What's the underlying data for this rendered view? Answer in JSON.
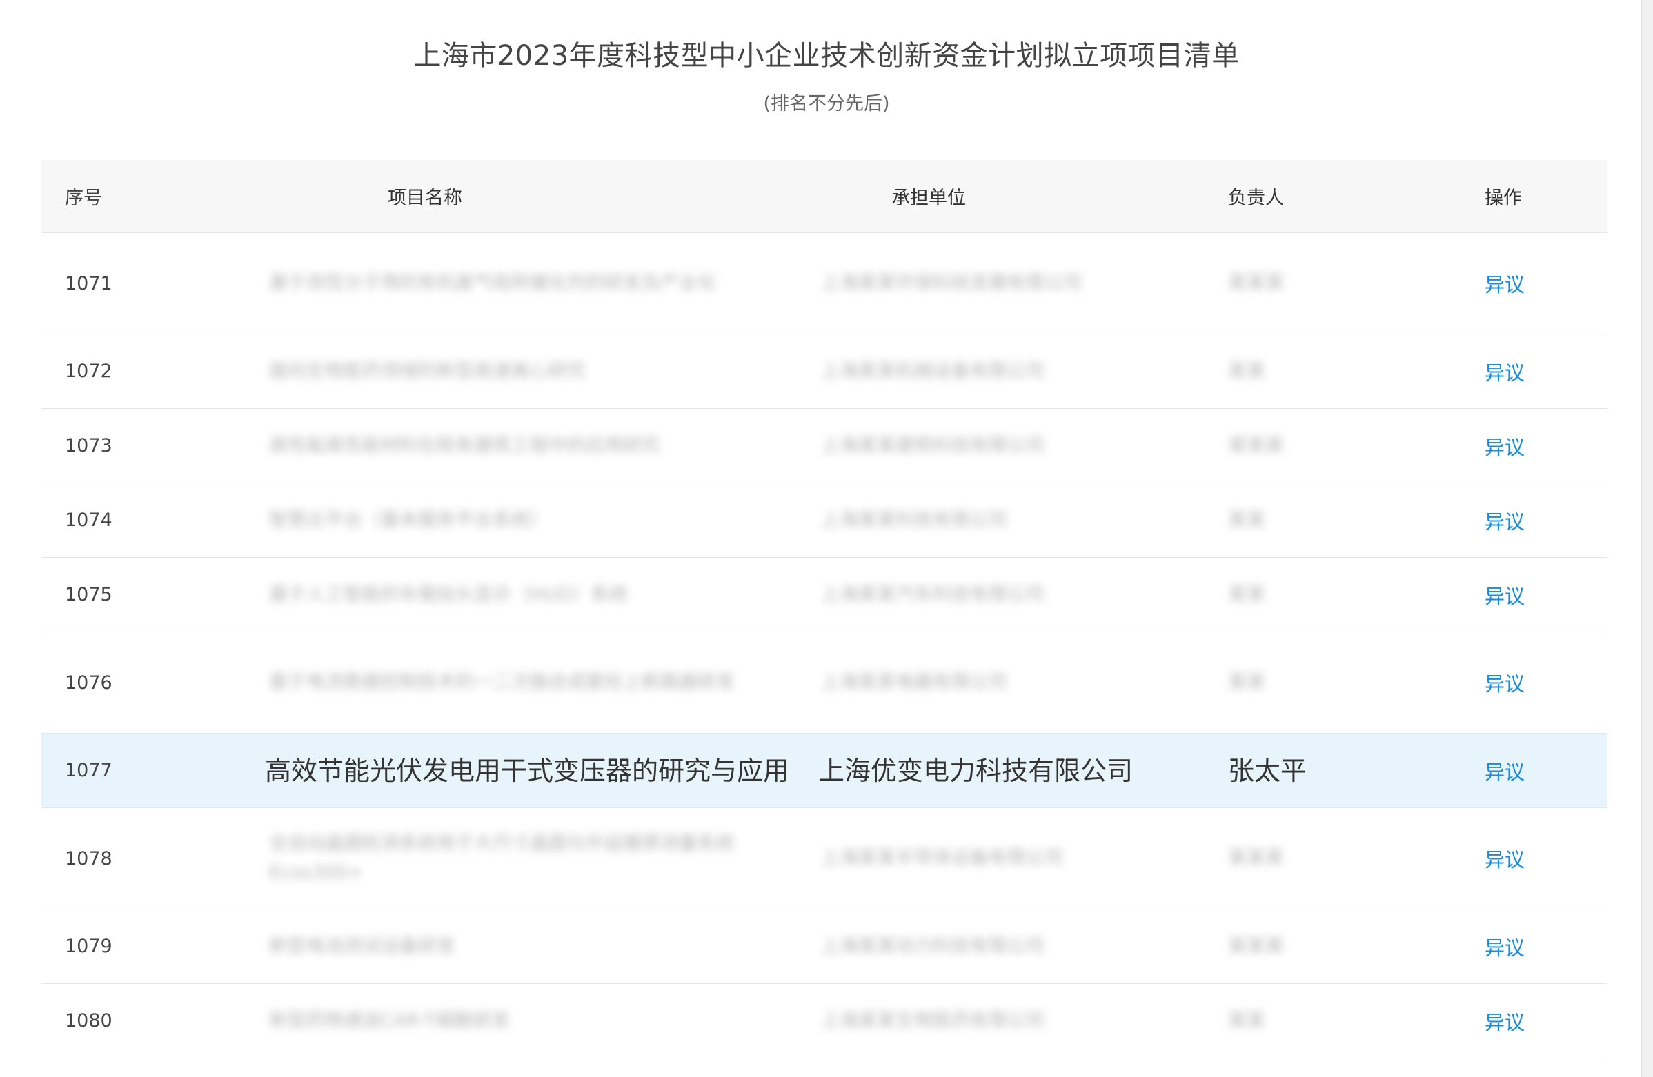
{
  "page": {
    "title": "上海市2023年度科技型中小企业技术创新资金计划拟立项项目清单",
    "subtitle": "(排名不分先后)"
  },
  "table": {
    "headers": {
      "no": "序号",
      "name": "项目名称",
      "unit": "承担单位",
      "person": "负责人",
      "op": "操作"
    },
    "rows": [
      {
        "no": "1071",
        "name": "基于改性分子筛的有机废气吸附催化剂的研发及产业化",
        "unit": "上海某某环保科技发展有限公司",
        "person": "某某某",
        "op": "异议"
      },
      {
        "no": "1072",
        "name": "面向生物医药领域的新型高速离心研究",
        "unit": "上海某某机械设备有限公司",
        "person": "某某",
        "op": "异议"
      },
      {
        "no": "1073",
        "name": "高性能高性能材料在既有建筑工程中的应用研究",
        "unit": "上海某某建筑科技有限公司",
        "person": "某某某",
        "op": "异议"
      },
      {
        "no": "1074",
        "name": "智慧云平台（基本服务平台系统）",
        "unit": "上海某某科技有限公司",
        "person": "某某",
        "op": "异议"
      },
      {
        "no": "1075",
        "name": "基于人工智能的车载抬头显示（HUD）系统",
        "unit": "上海某某汽车科技有限公司",
        "person": "某某",
        "op": "异议"
      },
      {
        "no": "1076",
        "name": "基于电流数据控制技术的一二次融合成套柱上断路器研发",
        "unit": "上海某某电器有限公司",
        "person": "某某",
        "op": "异议"
      },
      {
        "no": "1077",
        "name": "高效节能光伏发电用干式变压器的研究与应用",
        "unit": "上海优变电力科技有限公司",
        "person": "张太平",
        "op": "异议"
      },
      {
        "no": "1078",
        "name": "全自动晶圆检测系统用于大尺寸晶圆与外延膜厚测量系统 Ecos300+",
        "unit": "上海某某半导体设备有限公司",
        "person": "某某某",
        "op": "异议"
      },
      {
        "no": "1079",
        "name": "新型电池测试设备研发",
        "unit": "上海某某动力科技有限公司",
        "person": "某某某",
        "op": "异议"
      },
      {
        "no": "1080",
        "name": "新型药物递送CAR-T细胞研发",
        "unit": "上海某某生物医药有限公司",
        "person": "某某",
        "op": "异议"
      }
    ]
  }
}
